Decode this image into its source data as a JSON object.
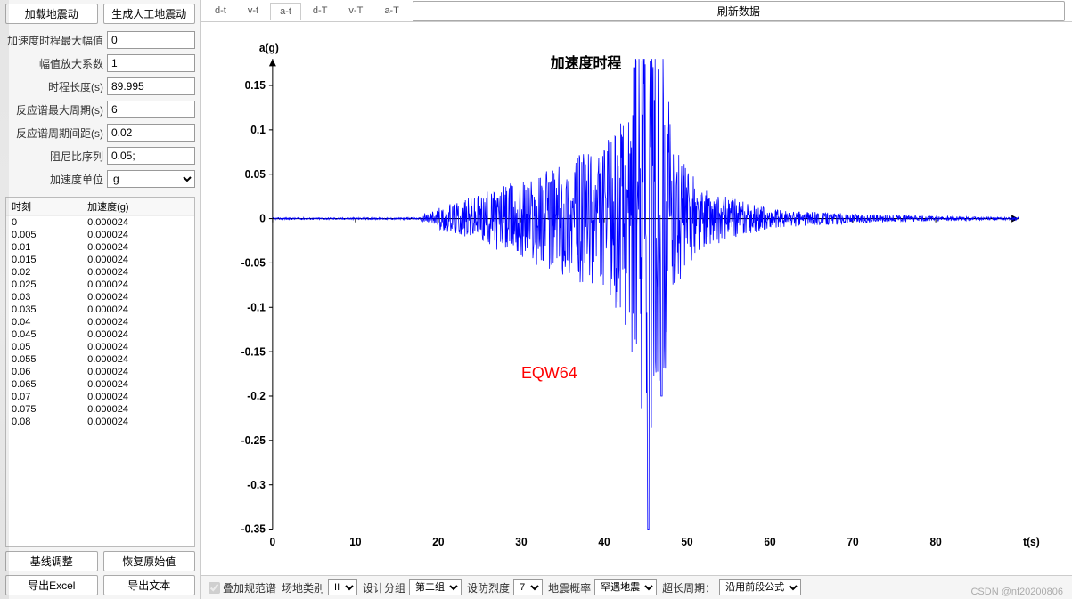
{
  "sidebar": {
    "load_btn": "加载地震动",
    "gen_btn": "生成人工地震动",
    "params": [
      {
        "label": "加速度时程最大幅值",
        "value": "0"
      },
      {
        "label": "幅值放大系数",
        "value": "1"
      },
      {
        "label": "时程长度(s)",
        "value": "89.995"
      },
      {
        "label": "反应谱最大周期(s)",
        "value": "6"
      },
      {
        "label": "反应谱周期间距(s)",
        "value": "0.02"
      },
      {
        "label": "阻尼比序列",
        "value": "0.05;"
      }
    ],
    "unit_label": "加速度单位",
    "unit_value": "g",
    "table_headers": [
      "时刻",
      "加速度(g)"
    ],
    "table_rows": [
      [
        "0",
        "0.000024"
      ],
      [
        "0.005",
        "0.000024"
      ],
      [
        "0.01",
        "0.000024"
      ],
      [
        "0.015",
        "0.000024"
      ],
      [
        "0.02",
        "0.000024"
      ],
      [
        "0.025",
        "0.000024"
      ],
      [
        "0.03",
        "0.000024"
      ],
      [
        "0.035",
        "0.000024"
      ],
      [
        "0.04",
        "0.000024"
      ],
      [
        "0.045",
        "0.000024"
      ],
      [
        "0.05",
        "0.000024"
      ],
      [
        "0.055",
        "0.000024"
      ],
      [
        "0.06",
        "0.000024"
      ],
      [
        "0.065",
        "0.000024"
      ],
      [
        "0.07",
        "0.000024"
      ],
      [
        "0.075",
        "0.000024"
      ],
      [
        "0.08",
        "0.000024"
      ]
    ],
    "baseline_btn": "基线调整",
    "restore_btn": "恢复原始值",
    "export_excel_btn": "导出Excel",
    "export_text_btn": "导出文本"
  },
  "tabs": [
    "d-t",
    "v-t",
    "a-t",
    "d-T",
    "v-T",
    "a-T"
  ],
  "active_tab": "a-t",
  "refresh_btn": "刷新数据",
  "chart_data": {
    "type": "line",
    "title": "加速度时程",
    "xlabel": "t(s)",
    "ylabel": "a(g)",
    "xlim": [
      0,
      90
    ],
    "ylim": [
      -0.35,
      0.18
    ],
    "xticks": [
      0,
      10,
      20,
      30,
      40,
      50,
      60,
      70,
      80
    ],
    "yticks": [
      -0.35,
      -0.3,
      -0.25,
      -0.2,
      -0.15,
      -0.1,
      -0.05,
      0,
      0.05,
      0.1,
      0.15
    ],
    "annotation": "EQW64",
    "series": [
      {
        "name": "acceleration",
        "color": "#0000ff",
        "note": "Seismic acceleration time history. Signal is near-zero until ~20s, builds through 25-40s with amplitudes roughly ±0.03 to ±0.08, peaks sharply between 43-48s with max ≈ +0.18 and min ≈ -0.35, then decays after 50s to small residual oscillations through 90s."
      }
    ]
  },
  "bottom": {
    "overlay_label": "叠加规范谱",
    "site_label": "场地类别",
    "site_value": "II",
    "group_label": "设计分组",
    "group_value": "第二组",
    "intensity_label": "设防烈度",
    "intensity_value": "7",
    "prob_label": "地震概率",
    "prob_value": "罕遇地震",
    "long_label": "超长周期：",
    "long_value": "沿用前段公式"
  },
  "watermark": "CSDN @nf20200806"
}
